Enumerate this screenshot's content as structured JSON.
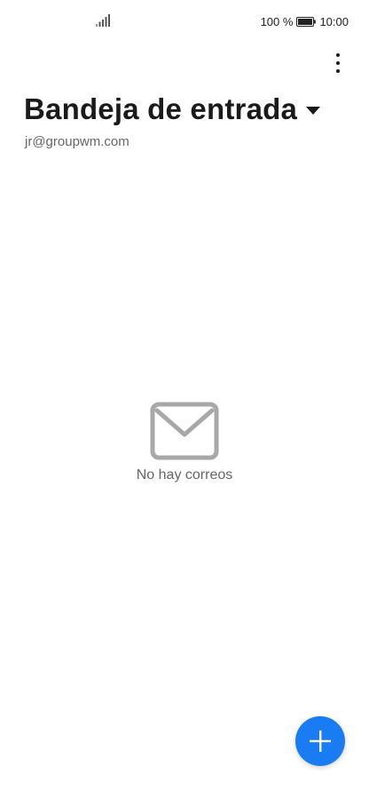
{
  "status_bar": {
    "battery_percent": "100 %",
    "time": "10:00",
    "battery_level": 1.0
  },
  "header": {
    "title": "Bandeja de entrada",
    "account": "jr@groupwm.com"
  },
  "empty_state": {
    "message": "No hay correos"
  },
  "icons": {
    "signal": "signal-icon",
    "battery": "battery-icon",
    "more": "more-vertical-icon",
    "dropdown": "caret-down-icon",
    "mail": "mail-icon",
    "compose": "plus-icon"
  },
  "colors": {
    "accent": "#1a7cf2",
    "muted_icon": "#a8a8a8"
  }
}
